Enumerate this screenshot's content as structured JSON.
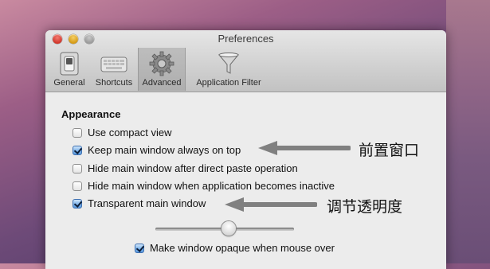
{
  "window": {
    "title": "Preferences"
  },
  "toolbar": {
    "items": [
      {
        "label": "General",
        "icon": "switch-icon"
      },
      {
        "label": "Shortcuts",
        "icon": "keyboard-icon"
      },
      {
        "label": "Advanced",
        "icon": "gear-icon",
        "selected": true
      },
      {
        "label": "Application Filter",
        "icon": "funnel-icon"
      }
    ]
  },
  "appearance": {
    "title": "Appearance",
    "options": [
      {
        "label": "Use compact view",
        "checked": false
      },
      {
        "label": "Keep main window always on top",
        "checked": true
      },
      {
        "label": "Hide main window after direct paste operation",
        "checked": false
      },
      {
        "label": "Hide main window when application becomes inactive",
        "checked": false
      },
      {
        "label": "Transparent main window",
        "checked": true
      }
    ],
    "opaque_option": {
      "label": "Make window opaque when mouse over",
      "checked": true
    },
    "transparency_level": 0.53
  },
  "annotations": {
    "always_on_top": "前置窗口",
    "transparency": "调节透明度"
  },
  "colors": {
    "annotation_arrow": "#808080",
    "checkbox_checked": "#6aa3e3"
  }
}
